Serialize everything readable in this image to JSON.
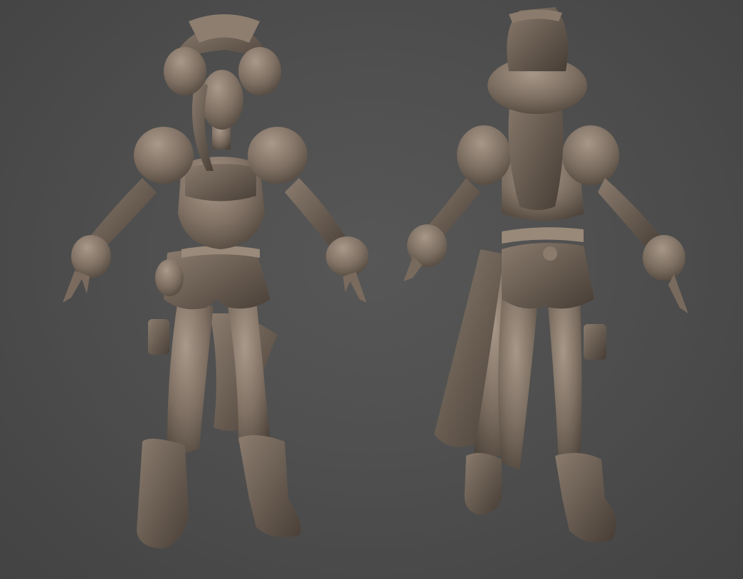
{
  "scene": {
    "background_color": "#4b4b4b",
    "material_color": "#8a7a6c",
    "views": [
      {
        "name": "front-view"
      },
      {
        "name": "back-view"
      }
    ]
  }
}
